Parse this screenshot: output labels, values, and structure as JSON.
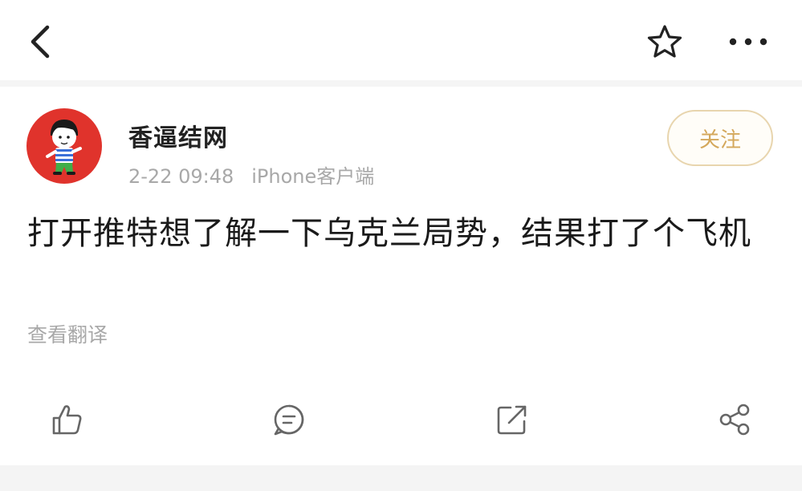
{
  "topbar": {
    "back_icon": "chevron-left-icon",
    "favorite_icon": "star-outline-icon",
    "more_icon": "more-horizontal-icon"
  },
  "post": {
    "author": "香逼结网",
    "date": "2-22 09:48",
    "source": "iPhone客户端",
    "follow_label": "关注",
    "text": "打开推特想了解一下乌克兰局势，结果打了个飞机",
    "translate_label": "查看翻译",
    "avatar_icon": "cartoon-boy-avatar"
  },
  "actions": {
    "like_icon": "thumbs-up-icon",
    "comment_icon": "comment-icon",
    "repost_icon": "repost-icon",
    "share_icon": "share-icon"
  },
  "colors": {
    "avatar_bg": "#e0332c",
    "follow_text": "#d4a85c",
    "follow_border": "#e8d5ae",
    "meta_gray": "#a8a8a8"
  }
}
